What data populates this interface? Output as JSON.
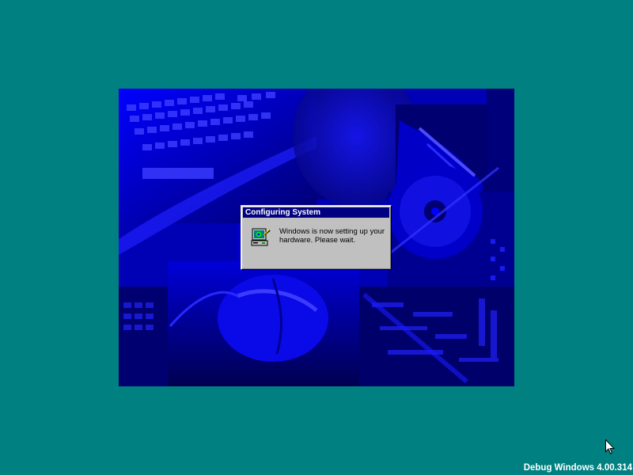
{
  "desktop": {
    "background_color": "#008080"
  },
  "splash": {
    "description_icon": "setup-collage-image"
  },
  "dialog": {
    "title": "Configuring System",
    "message_line1": "Windows is now setting up your",
    "message_line2": "hardware. Please wait.",
    "icon": "computer-setup-icon",
    "title_color": "#000080",
    "face_color": "#c0c0c0"
  },
  "cursor": {
    "icon": "arrow-cursor-icon"
  },
  "footer": {
    "build_label": "Debug Windows 4.00.314"
  }
}
